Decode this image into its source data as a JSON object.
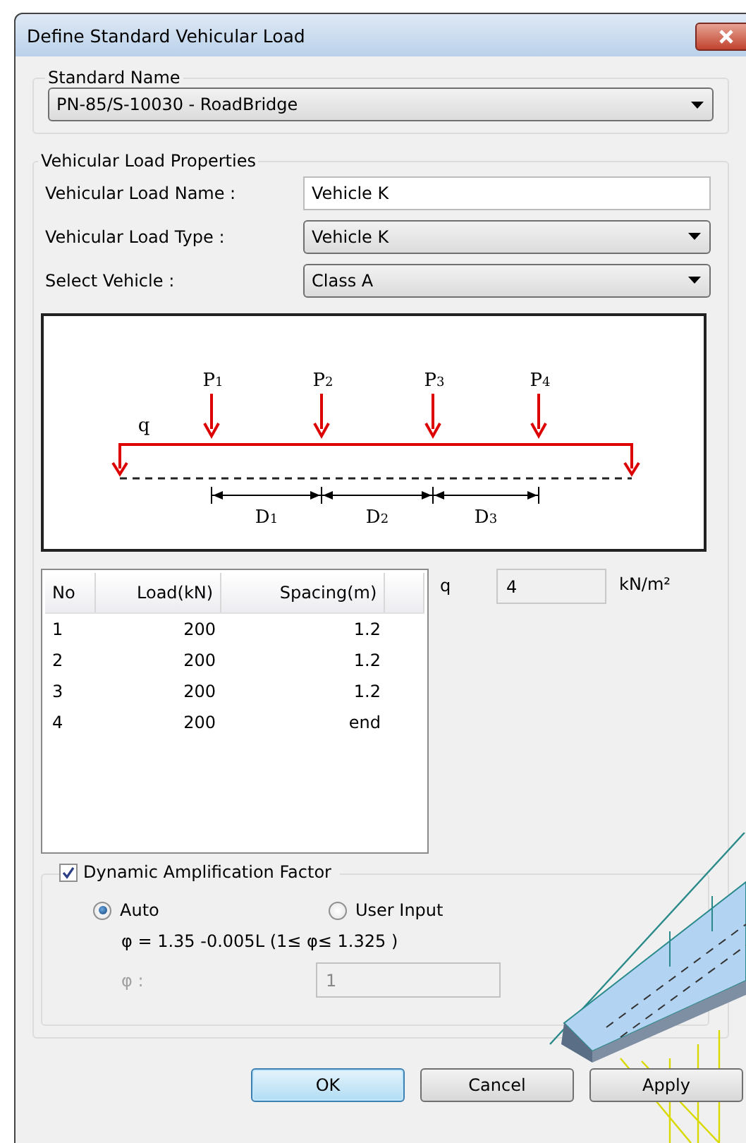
{
  "window": {
    "title": "Define Standard Vehicular Load"
  },
  "standard_name": {
    "legend": "Standard Name",
    "value": "PN-85/S-10030 - RoadBridge"
  },
  "properties": {
    "legend": "Vehicular Load Properties",
    "fields": [
      {
        "kind": "text",
        "label": "Vehicular Load Name :",
        "value": "Vehicle K"
      },
      {
        "kind": "dropdown",
        "label": "Vehicular Load Type :",
        "value": "Vehicle K"
      },
      {
        "kind": "dropdown",
        "label": "Select Vehicle :",
        "value": "Class A"
      }
    ]
  },
  "diagram": {
    "q_label": "q",
    "load_labels": [
      "P$_{1}$",
      "P$_{2}$",
      "P$_{3}$",
      "P$_{4}$"
    ],
    "spacing_labels": [
      "D$_{1}$",
      "D$_{2}$",
      "D$_{3}$"
    ]
  },
  "table": {
    "columns": [
      "No",
      "Load(kN)",
      "Spacing(m)"
    ],
    "rows": [
      [
        "1",
        "200",
        "1.2"
      ],
      [
        "2",
        "200",
        "1.2"
      ],
      [
        "3",
        "200",
        "1.2"
      ],
      [
        "4",
        "200",
        "end"
      ]
    ]
  },
  "q": {
    "label": "q",
    "value": "4",
    "unit": "kN/m²"
  },
  "dynamic": {
    "label": "Dynamic Amplification Factor",
    "checked": true,
    "options": [
      {
        "label": "Auto",
        "selected": true
      },
      {
        "label": "User Input",
        "selected": false
      }
    ],
    "formula": "φ = 1.35 -0.005L  (1≤ φ≤ 1.325 )",
    "phi_field": {
      "label": "φ :",
      "value": "1",
      "disabled": true
    }
  },
  "buttons": [
    {
      "label": "OK",
      "default": true
    },
    {
      "label": "Cancel",
      "default": false
    },
    {
      "label": "Apply",
      "default": false
    }
  ]
}
